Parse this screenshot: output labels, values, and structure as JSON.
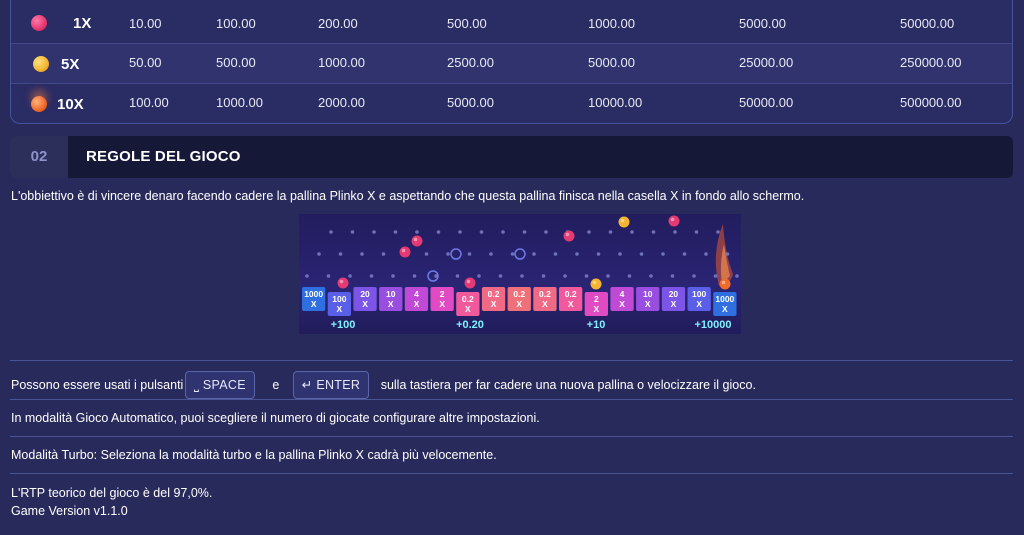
{
  "payout_table": {
    "rows": [
      {
        "multiplier": "1X",
        "ball_color": "#e4386f",
        "values": [
          "10.00",
          "100.00",
          "200.00",
          "500.00",
          "1000.00",
          "5000.00",
          "50000.00"
        ]
      },
      {
        "multiplier": "5X",
        "ball_color": "#f3b532",
        "values": [
          "50.00",
          "500.00",
          "1000.00",
          "2500.00",
          "5000.00",
          "25000.00",
          "250000.00"
        ]
      },
      {
        "multiplier": "10X",
        "ball_color": "#f06a2a",
        "values": [
          "100.00",
          "1000.00",
          "2000.00",
          "5000.00",
          "10000.00",
          "50000.00",
          "500000.00"
        ]
      }
    ]
  },
  "section": {
    "number": "02",
    "title": "REGOLE DEL GIOCO"
  },
  "intro_text": "L'obbiettivo è di vincere denaro facendo cadere la pallina Plinko X e aspettando che questa pallina finisca nella casella X in fondo allo schermo.",
  "game_preview": {
    "slots": [
      {
        "top": "1000",
        "bottom": "X",
        "color": "#2f6fe0"
      },
      {
        "top": "100",
        "bottom": "X",
        "color": "#5a5fe8"
      },
      {
        "top": "20",
        "bottom": "X",
        "color": "#7c55e6"
      },
      {
        "top": "10",
        "bottom": "X",
        "color": "#9a4ee0"
      },
      {
        "top": "4",
        "bottom": "X",
        "color": "#c04ad6"
      },
      {
        "top": "2",
        "bottom": "X",
        "color": "#e04ac2"
      },
      {
        "top": "0.2",
        "bottom": "X",
        "color": "#f05a9c"
      },
      {
        "top": "0.2",
        "bottom": "X",
        "color": "#f06a86"
      },
      {
        "top": "0.2",
        "bottom": "X",
        "color": "#f0707a"
      },
      {
        "top": "0.2",
        "bottom": "X",
        "color": "#f06a86"
      },
      {
        "top": "0.2",
        "bottom": "X",
        "color": "#f05a9c"
      },
      {
        "top": "2",
        "bottom": "X",
        "color": "#e04ac2"
      },
      {
        "top": "4",
        "bottom": "X",
        "color": "#c04ad6"
      },
      {
        "top": "10",
        "bottom": "X",
        "color": "#9a4ee0"
      },
      {
        "top": "20",
        "bottom": "X",
        "color": "#7c55e6"
      },
      {
        "top": "100",
        "bottom": "X",
        "color": "#5a5fe8"
      },
      {
        "top": "1000",
        "bottom": "X",
        "color": "#2f6fe0"
      }
    ],
    "wins": [
      "+100",
      "+0.20",
      "+10",
      "+10000"
    ]
  },
  "controls": {
    "prefix": "Possono essere usati i pulsanti",
    "key1": "SPACE",
    "conjunction": "e",
    "key2": "ENTER",
    "suffix": "sulla tastiera per far cadere una nuova pallina o velocizzare il gioco."
  },
  "auto_text": "In modalità Gioco Automatico, puoi scegliere il numero di giocate configurare altre impostazioni.",
  "turbo_text": "Modalità Turbo: Seleziona la modalità turbo e la pallina Plinko X cadrà più velocemente.",
  "rtp_text": "L'RTP teorico del gioco è del 97,0%.",
  "version_text": "Game Version v1.1.0",
  "colors": {
    "background": "#282a5c",
    "table_border": "#46529a",
    "accent_win": "#7ff0ff"
  }
}
